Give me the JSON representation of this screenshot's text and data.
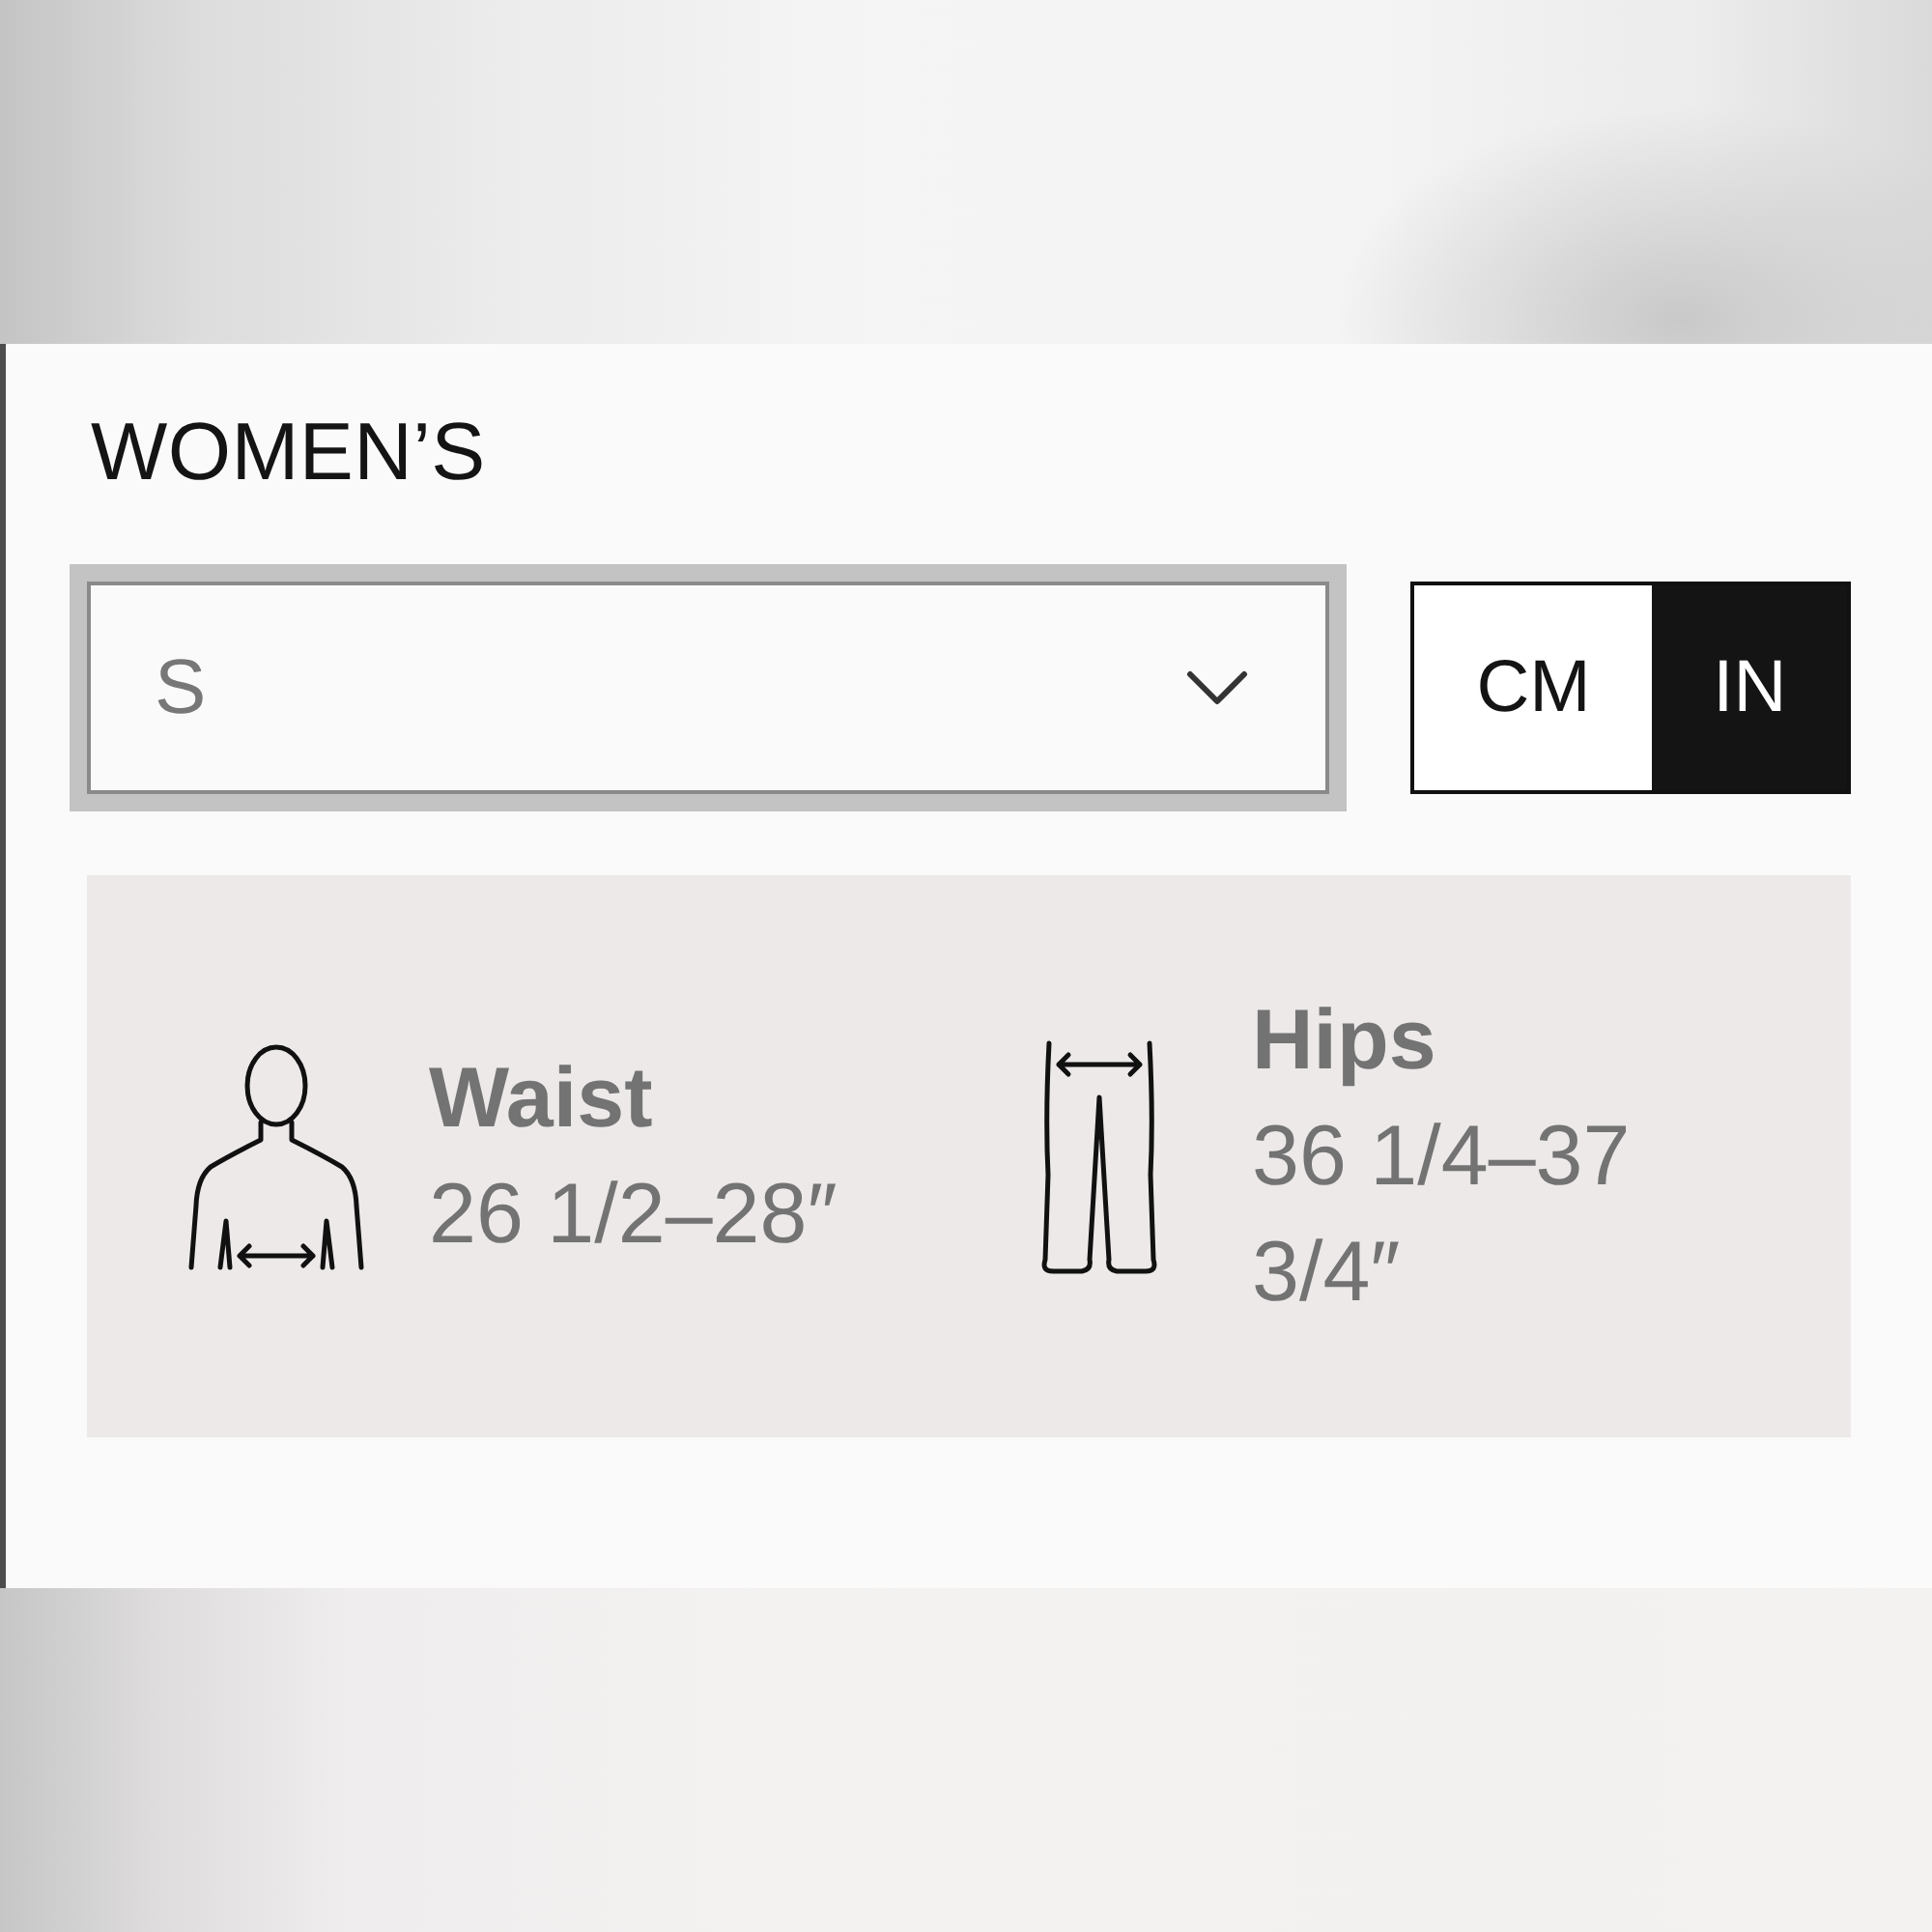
{
  "section": {
    "title": "WOMEN’S"
  },
  "size_select": {
    "value": "S"
  },
  "units": [
    {
      "label": "CM",
      "selected": false
    },
    {
      "label": "IN",
      "selected": true
    }
  ],
  "measurements": [
    {
      "kind": "waist",
      "label": "Waist",
      "value": "26 1/2–28″"
    },
    {
      "kind": "hips",
      "label": "Hips",
      "value": "36 1/4–37 3/4″"
    }
  ]
}
